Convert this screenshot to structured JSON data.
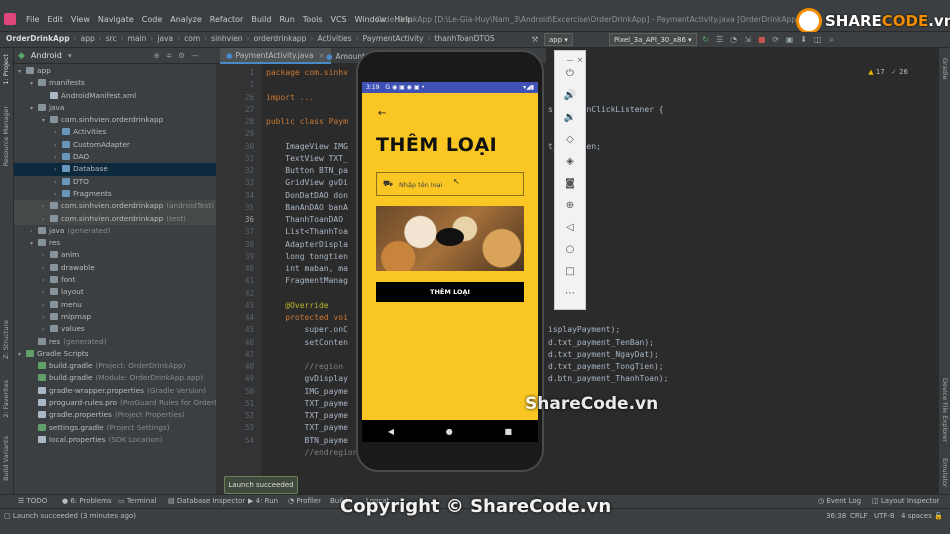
{
  "menu": {
    "items": [
      "File",
      "Edit",
      "View",
      "Navigate",
      "Code",
      "Analyze",
      "Refactor",
      "Build",
      "Run",
      "Tools",
      "VCS",
      "Window",
      "Help"
    ],
    "window_title": "OrderDrinkApp [D:\\Le-Gia-Huy\\Nam_3\\Android\\Excercise\\OrderDrinkApp] - PaymentActivity.java [OrderDrinkApp.app]"
  },
  "breadcrumbs": [
    "OrderDrinkApp",
    "app",
    "src",
    "main",
    "java",
    "com",
    "sinhvien",
    "orderdrinkapp",
    "Activities",
    "PaymentActivity",
    "thanhToanDTOS"
  ],
  "toolbar": {
    "config": "app",
    "device": "Pixel_3a_API_30_x86"
  },
  "project": {
    "header": "Android",
    "tree": [
      {
        "label": "app",
        "sub": "",
        "indent": 0,
        "arrow": "▾",
        "icon": "folder"
      },
      {
        "label": "manifests",
        "sub": "",
        "indent": 1,
        "arrow": "▾",
        "icon": "folder"
      },
      {
        "label": "AndroidManifest.xml",
        "sub": "",
        "indent": 2,
        "arrow": "",
        "icon": "file"
      },
      {
        "label": "java",
        "sub": "",
        "indent": 1,
        "arrow": "▾",
        "icon": "folder"
      },
      {
        "label": "com.sinhvien.orderdrinkapp",
        "sub": "",
        "indent": 2,
        "arrow": "▾",
        "icon": "folder"
      },
      {
        "label": "Activities",
        "sub": "",
        "indent": 3,
        "arrow": "›",
        "icon": "folder"
      },
      {
        "label": "CustomAdapter",
        "sub": "",
        "indent": 3,
        "arrow": "›",
        "icon": "folder"
      },
      {
        "label": "DAO",
        "sub": "",
        "indent": 3,
        "arrow": "›",
        "icon": "folder"
      },
      {
        "label": "Database",
        "sub": "",
        "indent": 3,
        "arrow": "›",
        "icon": "folder",
        "selected": "1"
      },
      {
        "label": "DTO",
        "sub": "",
        "indent": 3,
        "arrow": "›",
        "icon": "folder"
      },
      {
        "label": "Fragments",
        "sub": "",
        "indent": 3,
        "arrow": "›",
        "icon": "folder"
      },
      {
        "label": "com.sinhvien.orderdrinkapp",
        "sub": "(androidTest)",
        "indent": 2,
        "arrow": "›",
        "icon": "folder",
        "selected": "2"
      },
      {
        "label": "com.sinhvien.orderdrinkapp",
        "sub": "(test)",
        "indent": 2,
        "arrow": "›",
        "icon": "folder",
        "selected": "2"
      },
      {
        "label": "java",
        "sub": "(generated)",
        "indent": 1,
        "arrow": "›",
        "icon": "folder"
      },
      {
        "label": "res",
        "sub": "",
        "indent": 1,
        "arrow": "▾",
        "icon": "folder"
      },
      {
        "label": "anim",
        "sub": "",
        "indent": 2,
        "arrow": "›",
        "icon": "folder"
      },
      {
        "label": "drawable",
        "sub": "",
        "indent": 2,
        "arrow": "›",
        "icon": "folder"
      },
      {
        "label": "font",
        "sub": "",
        "indent": 2,
        "arrow": "›",
        "icon": "folder"
      },
      {
        "label": "layout",
        "sub": "",
        "indent": 2,
        "arrow": "›",
        "icon": "folder"
      },
      {
        "label": "menu",
        "sub": "",
        "indent": 2,
        "arrow": "›",
        "icon": "folder"
      },
      {
        "label": "mipmap",
        "sub": "",
        "indent": 2,
        "arrow": "›",
        "icon": "folder"
      },
      {
        "label": "values",
        "sub": "",
        "indent": 2,
        "arrow": "›",
        "icon": "folder"
      },
      {
        "label": "res",
        "sub": "(generated)",
        "indent": 1,
        "arrow": "",
        "icon": "folder"
      },
      {
        "label": "Gradle Scripts",
        "sub": "",
        "indent": 0,
        "arrow": "▾",
        "icon": "gradle"
      },
      {
        "label": "build.gradle",
        "sub": "(Project: OrderDrinkApp)",
        "indent": 1,
        "arrow": "",
        "icon": "gradle"
      },
      {
        "label": "build.gradle",
        "sub": "(Module: OrderDrinkApp.app)",
        "indent": 1,
        "arrow": "",
        "icon": "gradle"
      },
      {
        "label": "gradle-wrapper.properties",
        "sub": "(Gradle Version)",
        "indent": 1,
        "arrow": "",
        "icon": "file"
      },
      {
        "label": "proguard-rules.pro",
        "sub": "(ProGuard Rules for OrderDrink",
        "indent": 1,
        "arrow": "",
        "icon": "file"
      },
      {
        "label": "gradle.properties",
        "sub": "(Project Properties)",
        "indent": 1,
        "arrow": "",
        "icon": "file"
      },
      {
        "label": "settings.gradle",
        "sub": "(Project Settings)",
        "indent": 1,
        "arrow": "",
        "icon": "gradle"
      },
      {
        "label": "local.properties",
        "sub": "(SDK Location)",
        "indent": 1,
        "arrow": "",
        "icon": "file"
      }
    ]
  },
  "editor": {
    "tabs": [
      "PaymentActivity.java",
      "Amount"
    ],
    "line_numbers": [
      "1",
      "2",
      "26",
      "27",
      "28",
      "29",
      "30",
      "31",
      "32",
      "33",
      "34",
      "35",
      "36",
      "37",
      "38",
      "39",
      "40",
      "41",
      "42",
      "43",
      "44",
      "45",
      "46",
      "47",
      "48",
      "49",
      "50",
      "51",
      "52",
      "53",
      "54"
    ],
    "code": {
      "l1": "package com.sinhv",
      "l3": "import ...",
      "l27": "public class Paym",
      "l29": "    ImageView IMG",
      "l30": "    TextView TXT_",
      "l31": "    Button BTN_pa",
      "l32": "    GridView gvDi",
      "l33": "    DonDatDAO don",
      "l34": "    BanAnDAO banA",
      "l35": "    ThanhToanDAO",
      "l36": "    List<ThanhToa",
      "l37": "    AdapterDispla",
      "l38": "    long tongtien",
      "l39": "    int maban, ma",
      "l40": "    FragmentManag",
      "l42": "    @Override",
      "l43": "    protected voi",
      "l44": "        super.onC",
      "l45": "        setConten",
      "l47": "        //region",
      "l48": "        gvDisplay",
      "l49": "        IMG_payme",
      "l50": "        TXT_payme",
      "l51": "        TXT_payme",
      "l52": "        TXT_payme",
      "l53": "        BTN_payme",
      "l54": "        //endregion"
    },
    "right_code": [
      {
        "row": 3,
        "text": "s View.OnClickListener {"
      },
      {
        "row": 6,
        "text": "t_TongTien;"
      },
      {
        "row": 21,
        "text": "isplayPayment);"
      },
      {
        "row": 22,
        "text": "d.txt_payment_TenBan);"
      },
      {
        "row": 23,
        "text": "d.txt_payment_NgayDat);"
      },
      {
        "row": 24,
        "text": "d.txt_payment_TongTien);"
      },
      {
        "row": 25,
        "text": "d.btn_payment_ThanhToan);"
      }
    ],
    "inspection": {
      "warnings": "17",
      "weak": "26"
    }
  },
  "phone": {
    "time": "3:19",
    "title": "THÊM  LOẠI",
    "placeholder": "Nhập tên loại",
    "button": "THÊM LOẠI"
  },
  "left_tabs": [
    "1: Project",
    "Resource Manager",
    "Z: Structure",
    "2: Favorites",
    "Build Variants"
  ],
  "right_tabs": [
    "Gradle",
    "Device File Explorer",
    "Emulator"
  ],
  "bottom_tools": [
    "TODO",
    "6: Problems",
    "Terminal",
    "Database Inspector",
    "4: Run",
    "Profiler",
    "Build",
    "Logcat"
  ],
  "bottom_right": [
    "Event Log",
    "Layout Inspector"
  ],
  "status": {
    "message": "Launch succeeded (3 minutes ago)",
    "position": "36:38",
    "line_sep": "CRLF",
    "encoding": "UTF-8",
    "indent": "4 spaces"
  },
  "toast": "Launch succeeded",
  "watermarks": {
    "center": "ShareCode.vn",
    "bottom": "Copyright © ShareCode.vn",
    "logo_a": "SHARE",
    "logo_b": "CODE",
    ".vn": ".vn"
  }
}
